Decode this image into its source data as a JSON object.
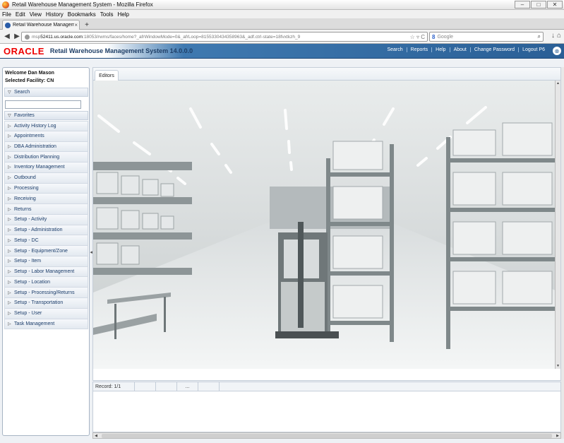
{
  "window": {
    "title": "Retail Warehouse Management System - Mozilla Firefox",
    "controls": {
      "minimize": "–",
      "maximize": "□",
      "close": "✕"
    }
  },
  "menubar": [
    "File",
    "Edit",
    "View",
    "History",
    "Bookmarks",
    "Tools",
    "Help"
  ],
  "browser_tab": {
    "label": "Retail Warehouse Management System",
    "close": "×",
    "new_tab": "+"
  },
  "nav": {
    "back": "◀",
    "forward": "▶",
    "url_prefix": "msp",
    "url_host": "52411.us.oracle.com",
    "url_rest": ":18053/rwms/faces/home?_afrWindowMode=0&_afrLoop=8155330434358963&_adf.ctrl-state=18fvxtkzh_9",
    "url_tools": "☆ ▿ C",
    "search_engine": "8",
    "search_placeholder": "Google",
    "search_go": "⌕",
    "right_icons": [
      "↓",
      "⌂"
    ]
  },
  "header": {
    "logo": "ORACLE",
    "title": "Retail Warehouse Management System 14.0.0.0",
    "links": [
      "Search",
      "Reports",
      "Help",
      "About",
      "Change Password",
      "Logout P6"
    ],
    "close_icon": "⊗"
  },
  "leftpanel": {
    "welcome": "Welcome Dan Mason",
    "facility": "Selected Facility: CN",
    "search_header": "Search",
    "favorites_header": "Favorites",
    "collapse_chev": "▽",
    "expand_chev": "▷",
    "menu": [
      "Activity History Log",
      "Appointments",
      "DBA Administration",
      "Distribution Planning",
      "Inventory Management",
      "Outbound",
      "Processing",
      "Receiving",
      "Returns",
      "Setup - Activity",
      "Setup - Administration",
      "Setup - DC",
      "Setup - Equipment/Zone",
      "Setup - Item",
      "Setup - Labor Management",
      "Setup - Location",
      "Setup - Processing/Returns",
      "Setup - Transportation",
      "Setup - User",
      "Task Management"
    ]
  },
  "splitter": "◀",
  "editor": {
    "tab_label": "Editors"
  },
  "status": {
    "record": "Record: 1/1",
    "cells": [
      "",
      "",
      "...",
      "",
      ""
    ]
  },
  "scroll": {
    "left": "◀",
    "right": "▶",
    "up": "▲",
    "down": "▼"
  },
  "colors": {
    "oracle_red": "#e00000",
    "header_blue": "#2a5f96",
    "menu_text": "#1a3c6a"
  }
}
